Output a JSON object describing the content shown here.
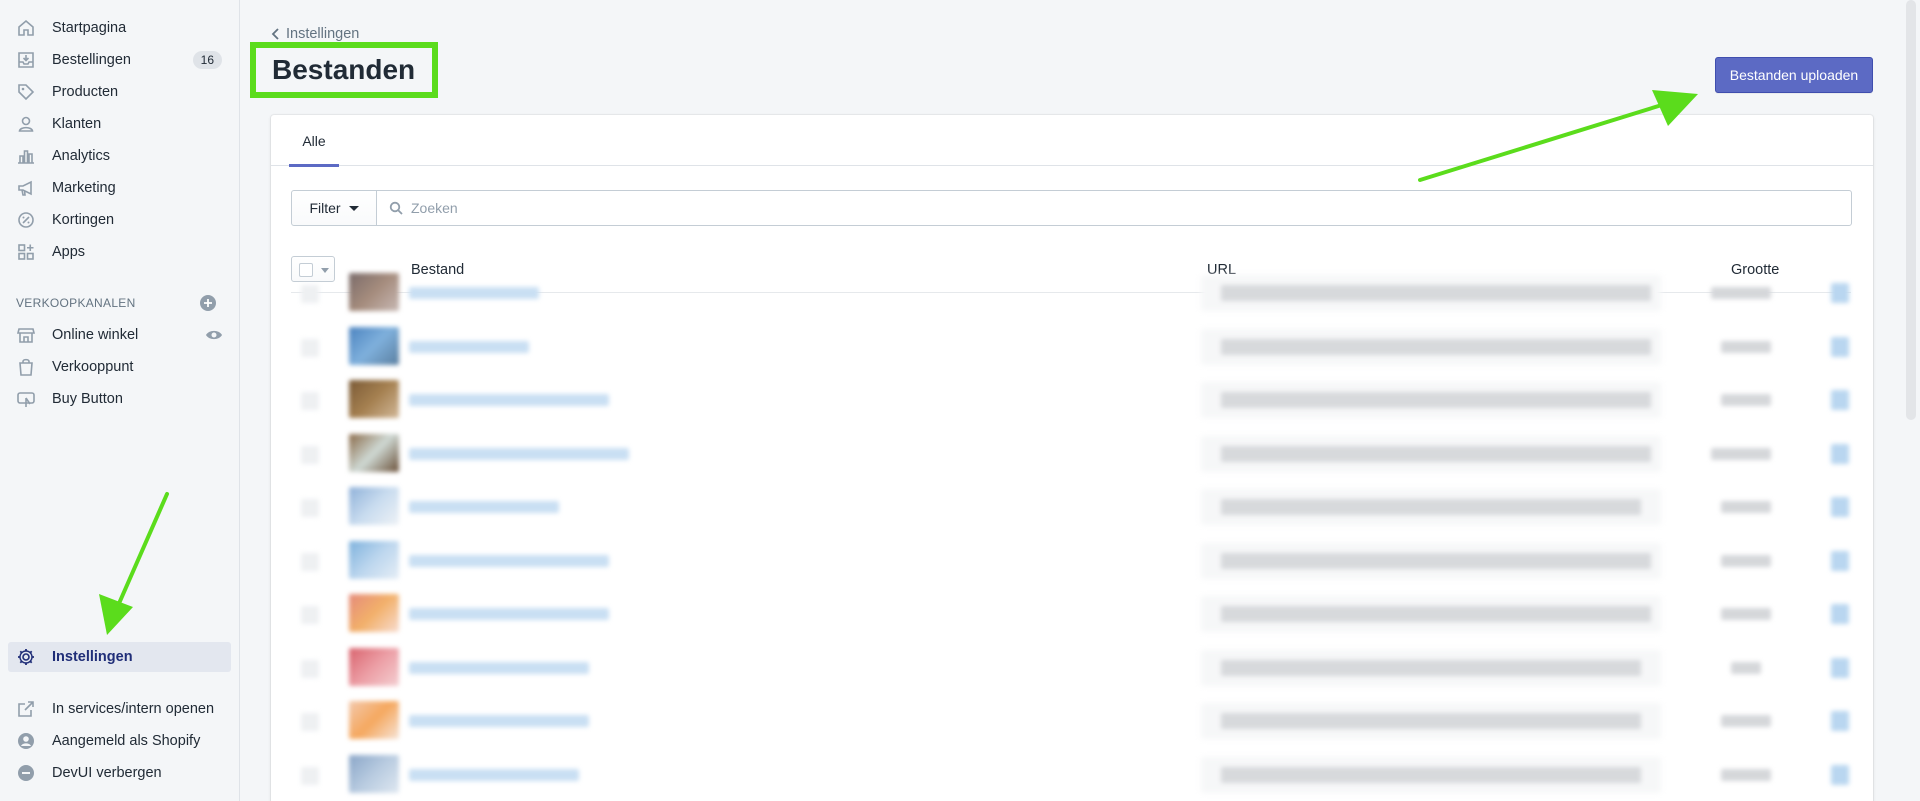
{
  "sidebar": {
    "items": [
      {
        "label": "Startpagina",
        "icon": "home-icon"
      },
      {
        "label": "Bestellingen",
        "icon": "orders-icon",
        "badge": "16"
      },
      {
        "label": "Producten",
        "icon": "tag-icon"
      },
      {
        "label": "Klanten",
        "icon": "person-icon"
      },
      {
        "label": "Analytics",
        "icon": "bar-chart-icon"
      },
      {
        "label": "Marketing",
        "icon": "megaphone-icon"
      },
      {
        "label": "Kortingen",
        "icon": "discount-icon"
      },
      {
        "label": "Apps",
        "icon": "apps-icon"
      }
    ],
    "channels_title": "VERKOOPKANALEN",
    "channels": [
      {
        "label": "Online winkel",
        "icon": "store-icon"
      },
      {
        "label": "Verkooppunt",
        "icon": "bag-icon"
      },
      {
        "label": "Buy Button",
        "icon": "buy-button-icon"
      }
    ],
    "settings": {
      "label": "Instellingen",
      "icon": "gear-icon"
    },
    "footer": [
      {
        "label": "In services/intern openen",
        "icon": "external-link-icon"
      },
      {
        "label": "Aangemeld als Shopify",
        "icon": "user-circle-icon"
      },
      {
        "label": "DevUI verbergen",
        "icon": "minus-circle-icon"
      }
    ]
  },
  "breadcrumb": "Instellingen",
  "page_title": "Bestanden",
  "upload_button": "Bestanden uploaden",
  "tabs": [
    "Alle"
  ],
  "filter_button": "Filter",
  "search_placeholder": "Zoeken",
  "table": {
    "columns": [
      "Bestand",
      "URL",
      "Grootte"
    ]
  },
  "colors": {
    "accent": "#5c6ac4",
    "highlight": "#5bdc1c",
    "active_nav": "#202e78"
  }
}
